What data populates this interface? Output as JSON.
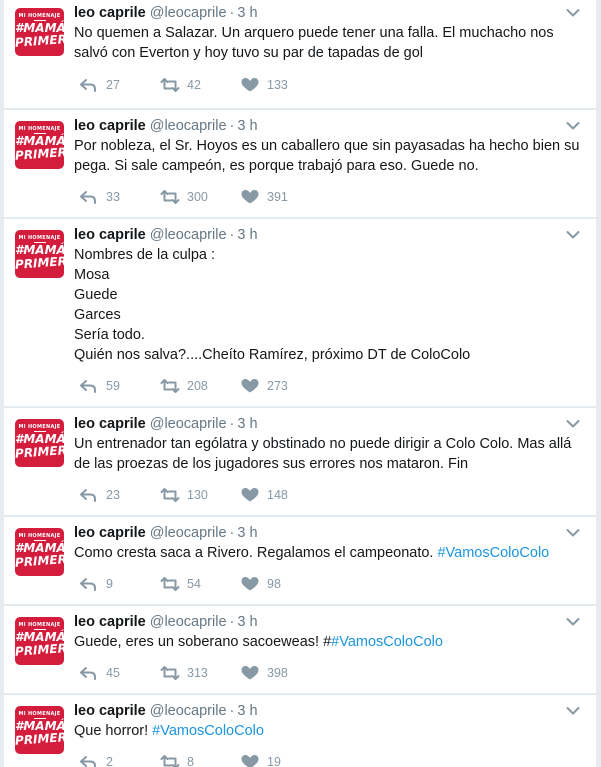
{
  "avatar": {
    "line1": "MI HOMENAJE",
    "line2": "#MAMÁ",
    "line3": "PRIMERO"
  },
  "tweets": [
    {
      "name": "leo caprile",
      "handle": "@leocaprile",
      "sep": "·",
      "time": "3 h",
      "lines": [
        [
          {
            "t": "No quemen a Salazar. Un arquero puede tener una falla. El muchacho nos"
          }
        ],
        [
          {
            "t": "salvó con Everton y hoy tuvo su par de tapadas de gol"
          }
        ]
      ],
      "replies": "27",
      "retweets": "42",
      "likes": "133"
    },
    {
      "name": "leo caprile",
      "handle": "@leocaprile",
      "sep": "·",
      "time": "3 h",
      "lines": [
        [
          {
            "t": "Por nobleza, el Sr. Hoyos es un caballero  que sin payasadas ha hecho bien su"
          }
        ],
        [
          {
            "t": "pega. Si sale campeón, es porque trabajó para eso. Guede no."
          }
        ]
      ],
      "replies": "33",
      "retweets": "300",
      "likes": "391"
    },
    {
      "name": "leo caprile",
      "handle": "@leocaprile",
      "sep": "·",
      "time": "3 h",
      "lines": [
        [
          {
            "t": "Nombres de la culpa :"
          }
        ],
        [
          {
            "t": "Mosa"
          }
        ],
        [
          {
            "t": "Guede"
          }
        ],
        [
          {
            "t": "Garces"
          }
        ],
        [
          {
            "t": "Sería todo."
          }
        ],
        [
          {
            "t": "Quién nos salva?....Cheíto Ramírez, próximo DT de ColoColo"
          }
        ]
      ],
      "replies": "59",
      "retweets": "208",
      "likes": "273"
    },
    {
      "name": "leo caprile",
      "handle": "@leocaprile",
      "sep": "·",
      "time": "3 h",
      "lines": [
        [
          {
            "t": "Un entrenador tan ególatra y obstinado no puede dirigir a Colo Colo. Mas allá"
          }
        ],
        [
          {
            "t": "de las proezas de los jugadores sus errores nos mataron. Fin"
          }
        ]
      ],
      "replies": "23",
      "retweets": "130",
      "likes": "148"
    },
    {
      "name": "leo caprile",
      "handle": "@leocaprile",
      "sep": "·",
      "time": "3 h",
      "lines": [
        [
          {
            "t": "Como cresta saca a Rivero. Regalamos el campeonato. "
          },
          {
            "t": "#VamosColoColo",
            "h": true
          }
        ]
      ],
      "replies": "9",
      "retweets": "54",
      "likes": "98"
    },
    {
      "name": "leo caprile",
      "handle": "@leocaprile",
      "sep": "·",
      "time": "3 h",
      "lines": [
        [
          {
            "t": "Guede, eres un soberano sacoeweas! #"
          },
          {
            "t": "#VamosColoColo",
            "h": true
          }
        ]
      ],
      "replies": "45",
      "retweets": "313",
      "likes": "398"
    },
    {
      "name": "leo caprile",
      "handle": "@leocaprile",
      "sep": "·",
      "time": "3 h",
      "lines": [
        [
          {
            "t": "Que horror! "
          },
          {
            "t": "#VamosColoColo",
            "h": true
          }
        ]
      ],
      "replies": "2",
      "retweets": "8",
      "likes": "19"
    }
  ]
}
